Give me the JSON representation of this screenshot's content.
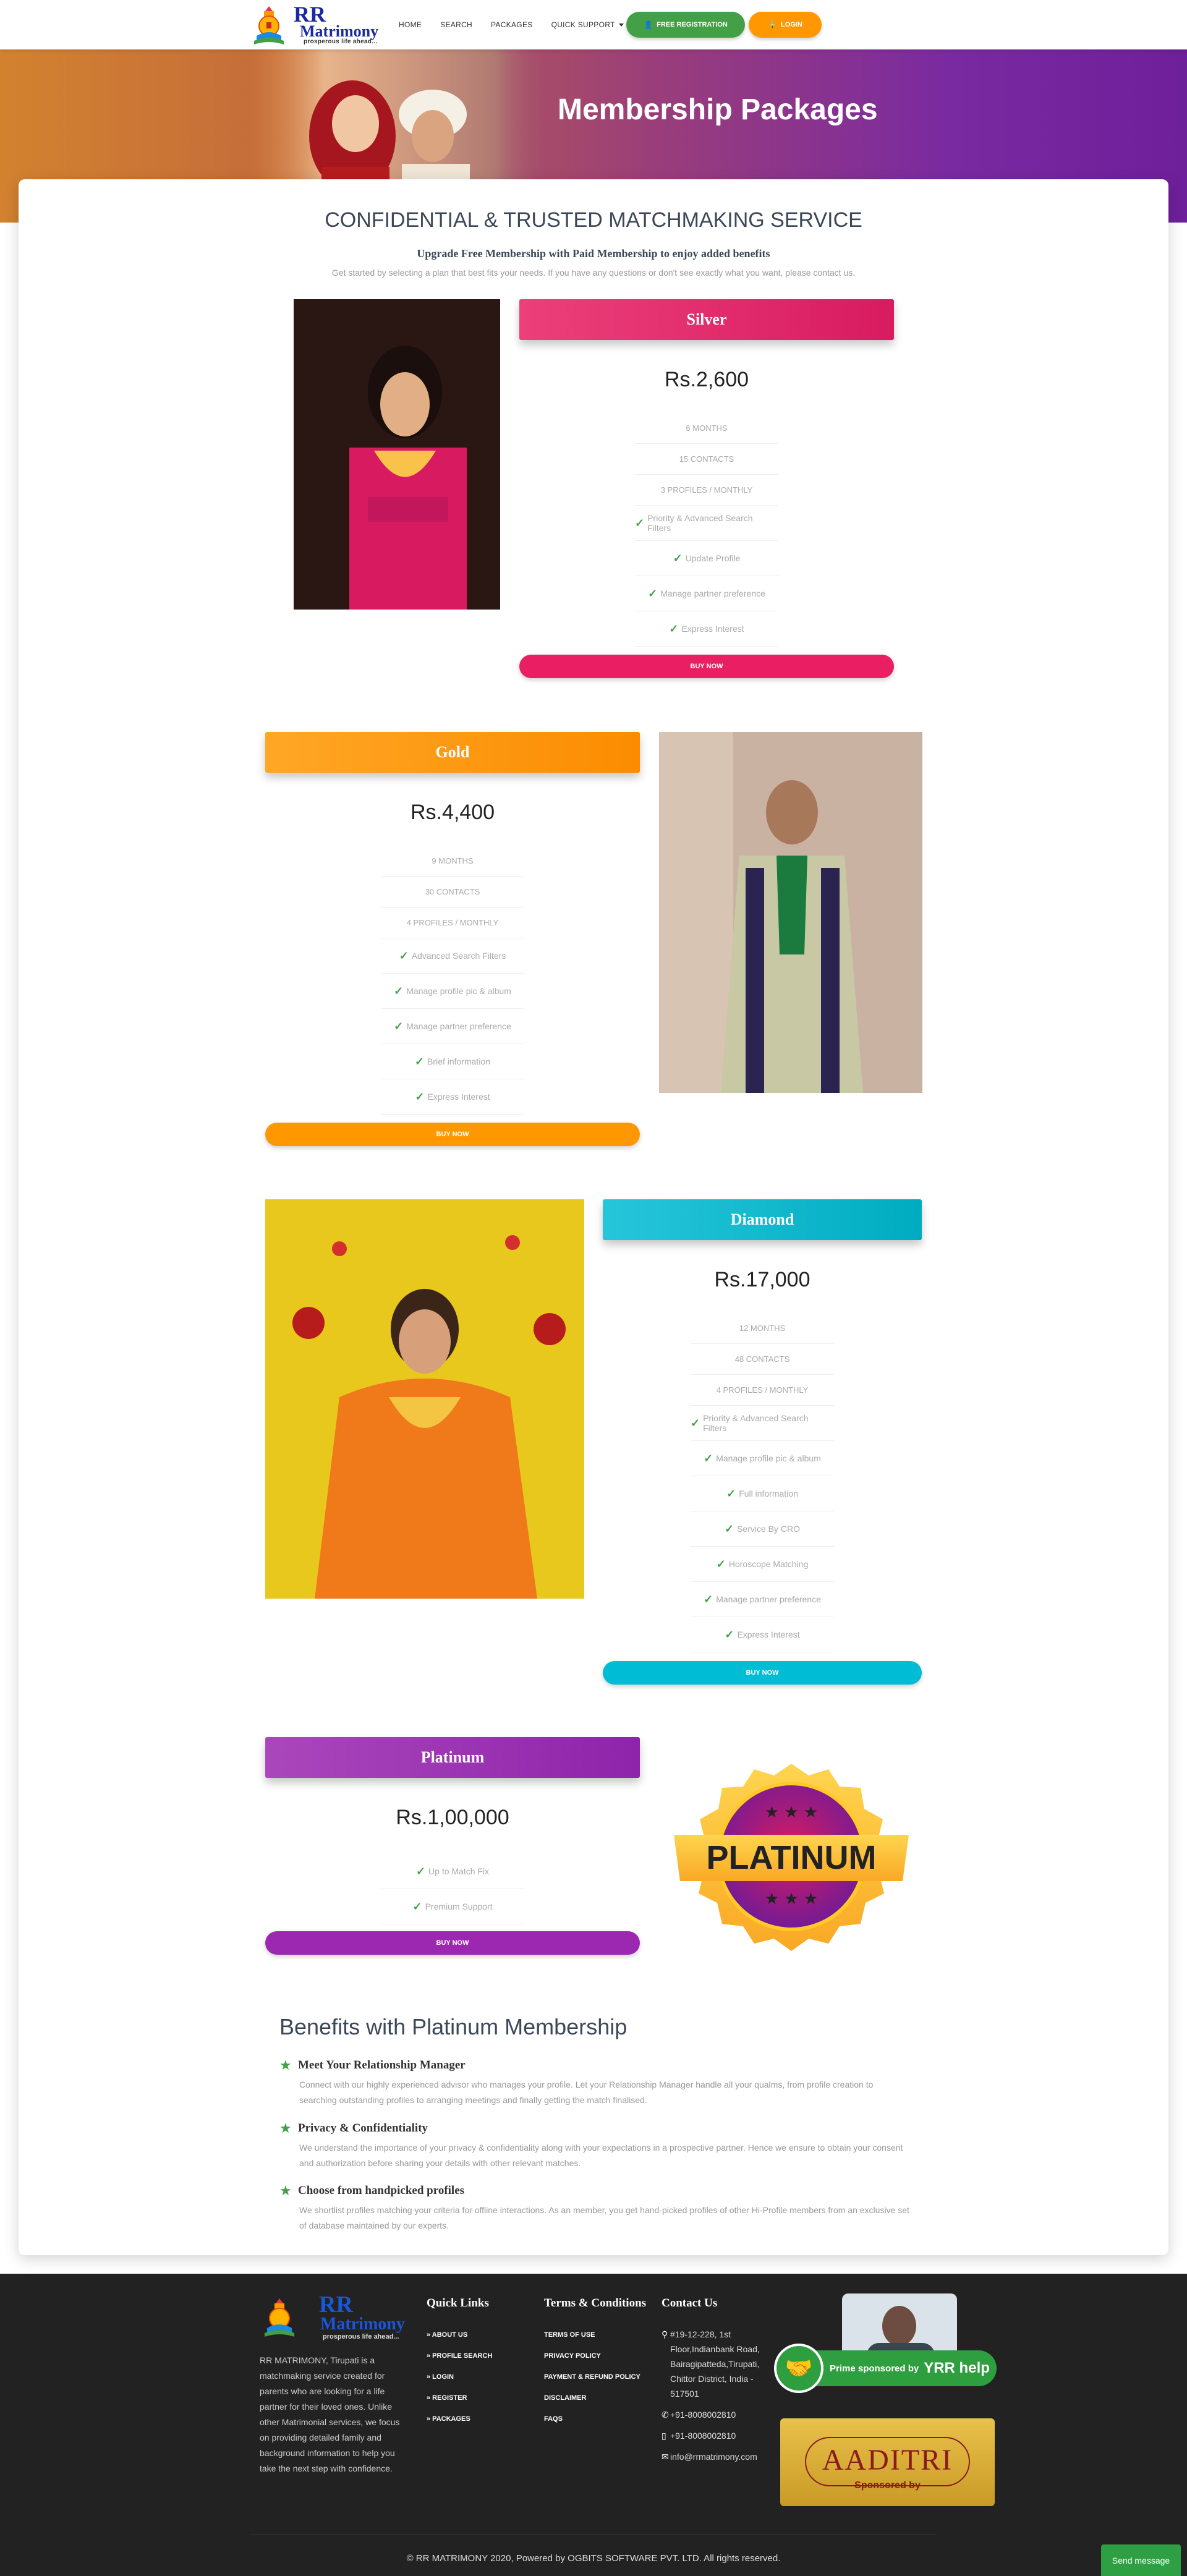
{
  "nav": {
    "logo_rr": "RR",
    "logo_name": "Matrimony",
    "logo_tagline": "prosperous life ahead...",
    "links": [
      "HOME",
      "SEARCH",
      "PACKAGES",
      "QUICK SUPPORT"
    ],
    "register_label": "FREE REGISTRATION",
    "login_label": "LOGIN"
  },
  "hero": {
    "title": "Membership Packages"
  },
  "intro": {
    "heading": "CONFIDENTIAL & TRUSTED MATCHMAKING SERVICE",
    "subheading": "Upgrade Free Membership with Paid Membership to enjoy added benefits",
    "note": "Get started by selecting a plan that best fits your needs. If you have any questions or don't see exactly what you want, please contact us."
  },
  "packages": {
    "silver": {
      "name": "Silver",
      "price": "Rs.2,600",
      "items": [
        "6 MONTHS",
        "15 CONTACTS",
        "3 PROFILES / MONTHLY"
      ],
      "features": [
        "Priority & Advanced Search Filters",
        "Update Profile",
        "Manage partner preference",
        "Express Interest"
      ],
      "button": "BUY NOW",
      "color": "#e91e63"
    },
    "gold": {
      "name": "Gold",
      "price": "Rs.4,400",
      "items": [
        "9 MONTHS",
        "30 CONTACTS",
        "4 PROFILES / MONTHLY"
      ],
      "features": [
        "Advanced Search Filters",
        "Manage profile pic & album",
        "Manage partner preference",
        "Brief information",
        "Express Interest"
      ],
      "button": "BUY NOW",
      "color": "#ff9800"
    },
    "diamond": {
      "name": "Diamond",
      "price": "Rs.17,000",
      "items": [
        "12 MONTHS",
        "48 CONTACTS",
        "4 PROFILES / MONTHLY"
      ],
      "features": [
        "Priority & Advanced Search Filters",
        "Manage profile pic & album",
        "Full information",
        "Service By CRO",
        "Horoscope Matching",
        "Manage partner preference",
        "Express Interest"
      ],
      "button": "BUY NOW",
      "color": "#00bcd4"
    },
    "platinum": {
      "name": "Platinum",
      "price": "Rs.1,00,000",
      "features": [
        "Up to Match Fix",
        "Premium Support"
      ],
      "button": "BUY NOW",
      "color": "#9c27b0",
      "badge_text": "PLATINUM"
    }
  },
  "benefits": {
    "title": "Benefits with Platinum Membership",
    "items": [
      {
        "title": "Meet Your Relationship Manager",
        "desc": "Connect with our highly experienced advisor who manages your profile. Let your Relationship Manager handle all your qualms, from profile creation to searching outstanding profiles to arranging meetings and finally getting the match finalised."
      },
      {
        "title": "Privacy & Confidentiality",
        "desc": "We understand the importance of your privacy & confidentiality along with your expectations in a prospective partner. Hence we ensure to obtain your consent and authorization before sharing your details with other relevant matches."
      },
      {
        "title": "Choose from handpicked profiles",
        "desc": "We shortlist profiles matching your criteria for offline interactions. As an member, you get hand-picked profiles of other Hi-Profile members from an exclusive set of database maintained by our experts."
      }
    ]
  },
  "footer": {
    "about": "RR MATRIMONY, Tirupati is a matchmaking service created for parents who are looking for a life partner for their loved ones. Unlike other Matrimonial services, we focus on providing detailed family and background information to help you take the next step with confidence.",
    "quick_links_title": "Quick Links",
    "quick_links": [
      "» ABOUT US",
      "» PROFILE SEARCH",
      "» LOGIN",
      "» REGISTER",
      "» PACKAGES"
    ],
    "terms_title": "Terms & Conditions",
    "terms_links": [
      "TERMS OF USE",
      "PRIVACY POLICY",
      "PAYMENT & REFUND POLICY",
      "DISCLAIMER",
      "FAQS"
    ],
    "contact_title": "Contact Us",
    "address": "#19-12-228, 1st Floor,Indianbank Road, Bairagipatteda,Tirupati, Chittor District, India - 517501",
    "phone": "+91-8008002810",
    "mobile": "+91-8008002810",
    "email": "info@rrmatrimony.com",
    "sponsor1_text": "Prime sponsored by",
    "sponsor1_brand": "YRR help",
    "sponsor2_brand": "AADITRI",
    "sponsor2_text": "Sponsored by",
    "copyright": "© RR MATRIMONY 2020, Powered by OGBITS SOFTWARE PVT. LTD. All rights reserved.",
    "send_message": "Send message"
  }
}
